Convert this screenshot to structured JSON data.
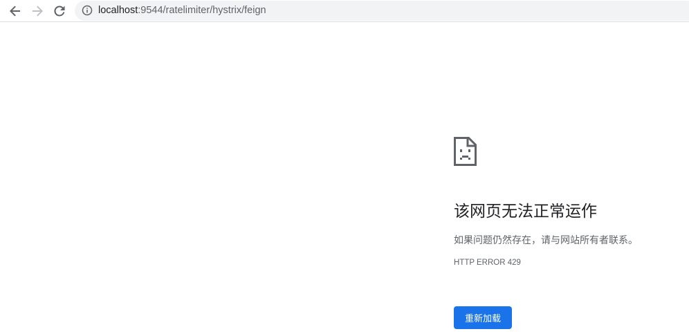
{
  "browser": {
    "url_host": "localhost",
    "url_rest": ":9544/ratelimiter/hystrix/feign"
  },
  "icons": {
    "back": "back-arrow-icon",
    "forward": "forward-arrow-icon",
    "reload": "reload-icon",
    "site_info": "info-icon",
    "error": "sad-page-icon"
  },
  "error_page": {
    "title": "该网页无法正常运作",
    "description": "如果问题仍然存在，请与网站所有者联系。",
    "error_code": "HTTP ERROR 429",
    "reload_button_label": "重新加载"
  },
  "colors": {
    "button_bg": "#1a73e8",
    "omnibox_bg": "#f1f3f4",
    "title_text": "#202124",
    "secondary_text": "#5f6368"
  }
}
